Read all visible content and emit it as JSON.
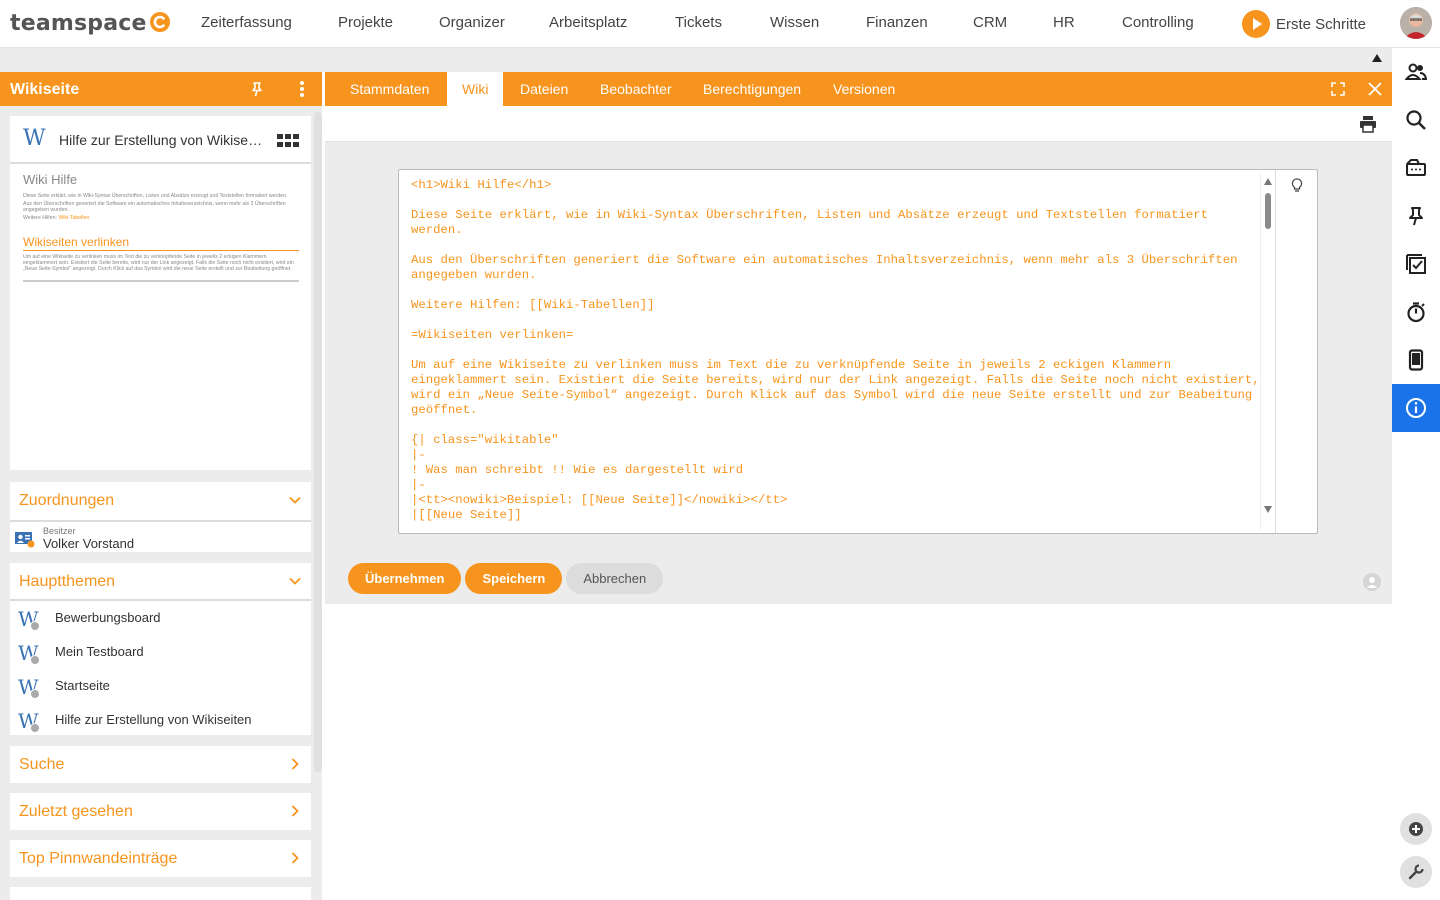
{
  "app": {
    "logo_text": "teamspace",
    "accent_color": "#f7941d",
    "active_color": "#1a73e8"
  },
  "nav": {
    "items": [
      "Zeiterfassung",
      "Projekte",
      "Organizer",
      "Arbeitsplatz",
      "Tickets",
      "Wissen",
      "Finanzen",
      "CRM",
      "HR",
      "Controlling"
    ],
    "first_steps": "Erste Schritte"
  },
  "left": {
    "header": "Wikiseite",
    "preview": {
      "title": "Hilfe zur Erstellung von Wikiseiten",
      "heading": "Wiki Hilfe",
      "para1": "Diese Seite erklärt, wie in Wiki-Syntax Überschriften, Listen und Absätze erzeugt und Textstellen formatiert werden.",
      "para2": "Aus den Überschriften generiert die Software ein automatisches Inhaltsverzeichnis, wenn mehr als 3 Überschriften angegeben wurden.",
      "para3_prefix": "Weitere Hilfen: ",
      "para3_link": "Wiki-Tabellen",
      "heading2": "Wikiseiten verlinken",
      "para4": "Um auf eine Wikiseite zu verlinken muss im Text die zu verknüpfende Seite in jeweils 2 eckigen Klammern eingeklammert sein. Existiert die Seite bereits, wird nur der Link angezeigt. Falls die Seite noch nicht existiert, wird ein „Neue Seite-Symbol“ angezeigt. Durch Klick auf das Symbol wird die neue Seite erstellt und zur Beabeitung geöffnet."
    },
    "assignments": {
      "title": "Zuordnungen",
      "owner_label": "Besitzer",
      "owner_name": "Volker Vorstand"
    },
    "topics": {
      "title": "Hauptthemen",
      "items": [
        "Bewerbungsboard",
        "Mein Testboard",
        "Startseite",
        "Hilfe zur Erstellung von Wikiseiten"
      ]
    },
    "sections": [
      "Suche",
      "Zuletzt gesehen",
      "Top Pinnwandeinträge"
    ]
  },
  "tabs": [
    "Stammdaten",
    "Wiki",
    "Dateien",
    "Beobachter",
    "Berechtigungen",
    "Versionen"
  ],
  "active_tab": "Wiki",
  "editor": {
    "text": "<h1>Wiki Hilfe</h1>\n\nDiese Seite erklärt, wie in Wiki-Syntax Überschriften, Listen und Absätze erzeugt und Textstellen formatiert werden.\n\nAus den Überschriften generiert die Software ein automatisches Inhaltsverzeichnis, wenn mehr als 3 Überschriften angegeben wurden.\n\nWeitere Hilfen: [[Wiki-Tabellen]]\n\n=Wikiseiten verlinken=\n\nUm auf eine Wikiseite zu verlinken muss im Text die zu verknüpfende Seite in jeweils 2 eckigen Klammern eingeklammert sein. Existiert die Seite bereits, wird nur der Link angezeigt. Falls die Seite noch nicht existiert, wird ein „Neue Seite-Symbol“ angezeigt. Durch Klick auf das Symbol wird die neue Seite erstellt und zur Beabeitung geöffnet.\n\n{| class=\"wikitable\"\n|-\n! Was man schreibt !! Wie es dargestellt wird\n|-\n|<tt><nowiki>Beispiel: [[Neue Seite]]</nowiki></tt>\n|[[Neue Seite]]\n\n|-\n|<tt><nowiki>Beispiel: [[Neue Seite|Hier steht ein anderer Text]]</nowiki></tt>"
  },
  "buttons": {
    "apply": "Übernehmen",
    "save": "Speichern",
    "cancel": "Abbrechen"
  },
  "rail_icons": [
    "contacts-icon",
    "search-icon",
    "inbox-icon",
    "pin-icon",
    "tasks-icon",
    "timer-icon",
    "mobile-icon",
    "info-icon"
  ]
}
